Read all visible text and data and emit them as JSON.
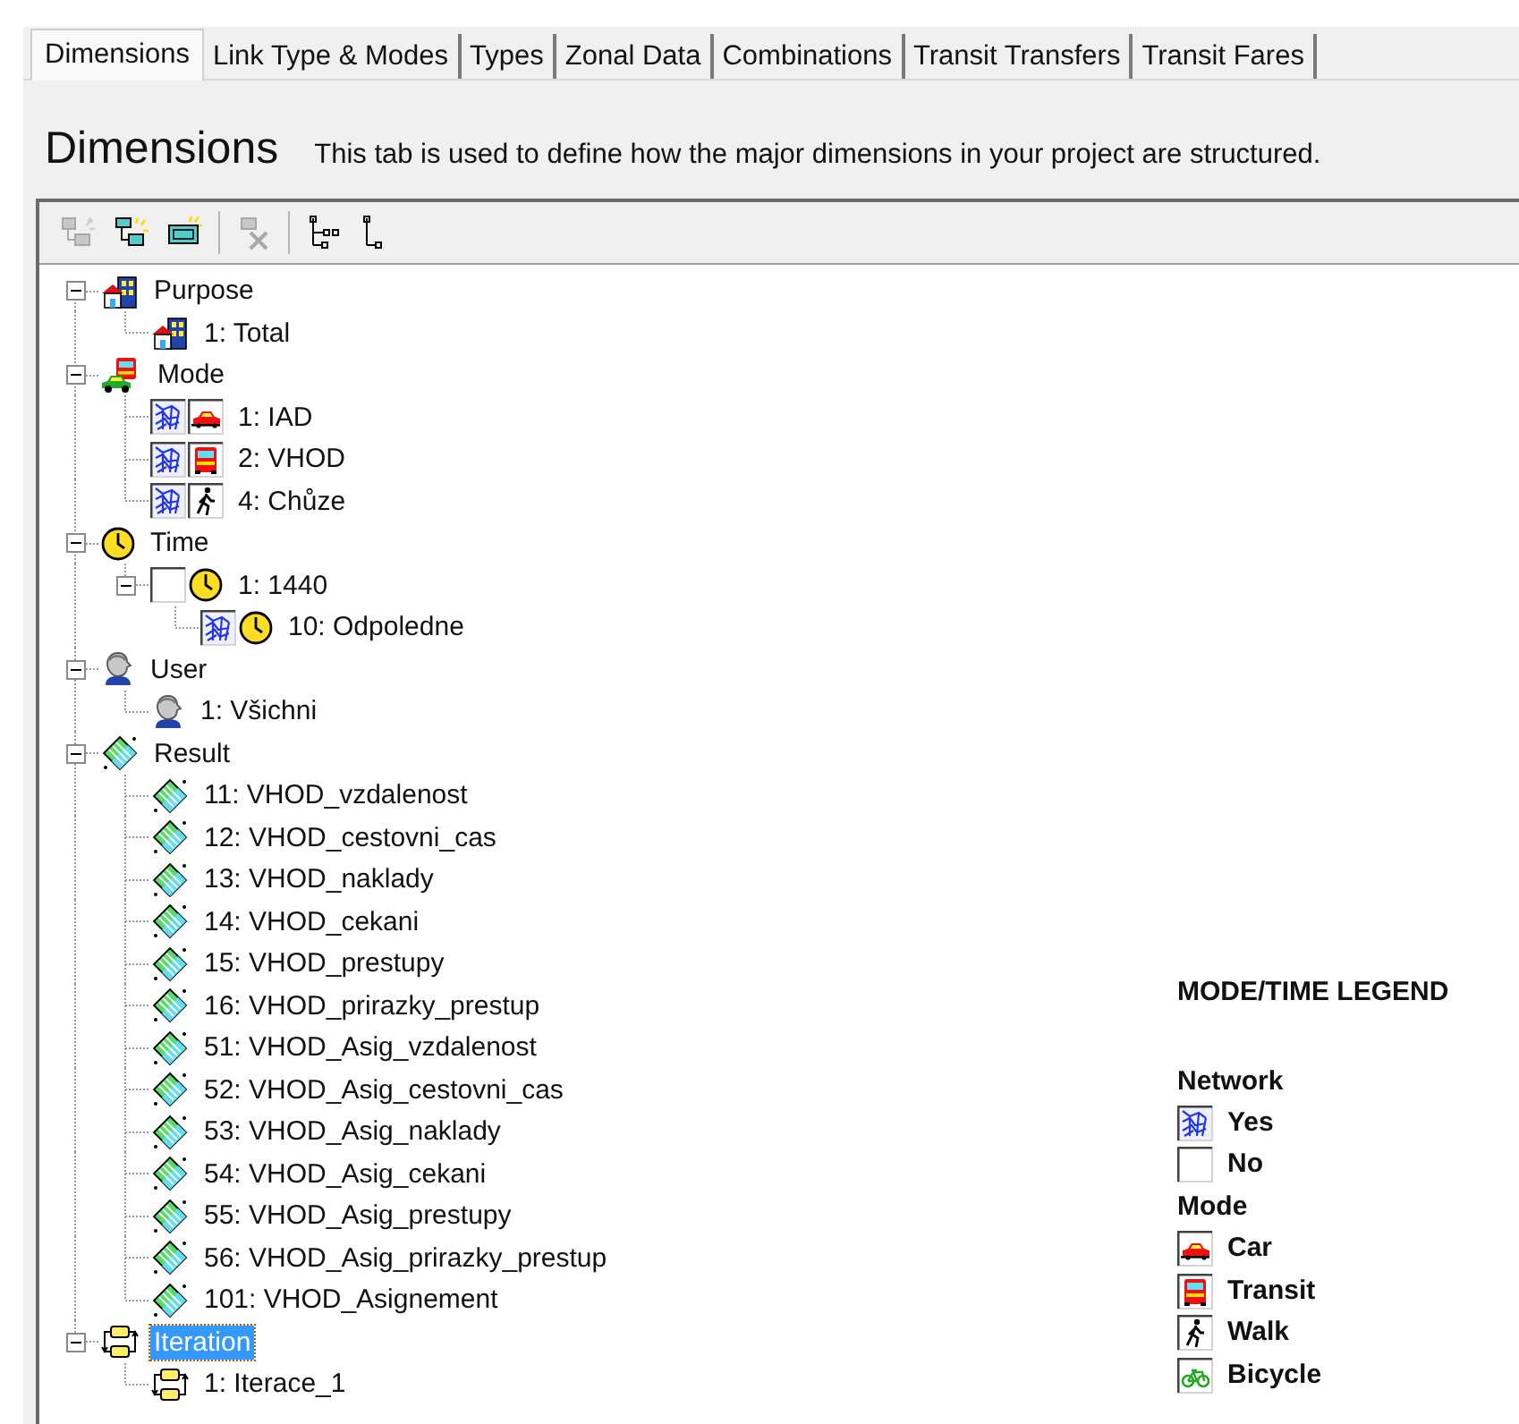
{
  "tabs": [
    {
      "label": "Dimensions",
      "selected": true
    },
    {
      "label": "Link Type & Modes",
      "selected": false
    },
    {
      "label": "Types",
      "selected": false
    },
    {
      "label": "Zonal Data",
      "selected": false
    },
    {
      "label": "Combinations",
      "selected": false
    },
    {
      "label": "Transit Transfers",
      "selected": false
    },
    {
      "label": "Transit Fares",
      "selected": false
    }
  ],
  "header": {
    "title": "Dimensions",
    "description": "This tab is used to define how the major dimensions in your project are structured."
  },
  "toolbar": [
    {
      "kind": "add_group",
      "disabled": true
    },
    {
      "kind": "add_item",
      "disabled": false
    },
    {
      "kind": "add_number",
      "disabled": false
    },
    {
      "kind": "delete",
      "disabled": true
    },
    {
      "kind": "expand",
      "disabled": false
    },
    {
      "kind": "collapse",
      "disabled": false
    }
  ],
  "tree": [
    {
      "label": "Purpose",
      "kind": "purpose",
      "expanded": true,
      "selected": false,
      "children": [
        {
          "label": "1: Total",
          "kind": "purpose",
          "selected": false
        }
      ]
    },
    {
      "label": "Mode",
      "kind": "mode",
      "expanded": true,
      "selected": false,
      "children": [
        {
          "label": "1: IAD",
          "kind": "car",
          "network": true,
          "selected": false
        },
        {
          "label": "2: VHOD",
          "kind": "transit",
          "network": true,
          "selected": false
        },
        {
          "label": "4: Chůze",
          "kind": "walk",
          "network": true,
          "selected": false
        }
      ]
    },
    {
      "label": "Time",
      "kind": "time",
      "expanded": true,
      "selected": false,
      "children": [
        {
          "label": "1: 1440",
          "kind": "time",
          "network": false,
          "expanded": true,
          "selected": false,
          "children": [
            {
              "label": "10: Odpoledne",
              "kind": "time",
              "network": true,
              "selected": false
            }
          ]
        }
      ]
    },
    {
      "label": "User",
      "kind": "user",
      "expanded": true,
      "selected": false,
      "children": [
        {
          "label": "1: Všichni",
          "kind": "user",
          "selected": false
        }
      ]
    },
    {
      "label": "Result",
      "kind": "result",
      "expanded": true,
      "selected": false,
      "children": [
        {
          "label": "11: VHOD_vzdalenost",
          "kind": "result",
          "selected": false
        },
        {
          "label": "12: VHOD_cestovni_cas",
          "kind": "result",
          "selected": false
        },
        {
          "label": "13: VHOD_naklady",
          "kind": "result",
          "selected": false
        },
        {
          "label": "14: VHOD_cekani",
          "kind": "result",
          "selected": false
        },
        {
          "label": "15: VHOD_prestupy",
          "kind": "result",
          "selected": false
        },
        {
          "label": "16: VHOD_prirazky_prestup",
          "kind": "result",
          "selected": false
        },
        {
          "label": "51: VHOD_Asig_vzdalenost",
          "kind": "result",
          "selected": false
        },
        {
          "label": "52: VHOD_Asig_cestovni_cas",
          "kind": "result",
          "selected": false
        },
        {
          "label": "53: VHOD_Asig_naklady",
          "kind": "result",
          "selected": false
        },
        {
          "label": "54: VHOD_Asig_cekani",
          "kind": "result",
          "selected": false
        },
        {
          "label": "55: VHOD_Asig_prestupy",
          "kind": "result",
          "selected": false
        },
        {
          "label": "56: VHOD_Asig_prirazky_prestup",
          "kind": "result",
          "selected": false
        },
        {
          "label": "101: VHOD_Asignement",
          "kind": "result",
          "selected": false
        }
      ]
    },
    {
      "label": "Iteration",
      "kind": "iteration",
      "expanded": true,
      "selected": true,
      "children": [
        {
          "label": "1: Iterace_1",
          "kind": "iteration",
          "selected": false
        }
      ]
    }
  ],
  "legend": {
    "title": "MODE/TIME LEGEND",
    "sections": [
      {
        "heading": "Network",
        "items": [
          {
            "label": "Yes",
            "kind": "network"
          },
          {
            "label": "No",
            "kind": "no_network"
          }
        ]
      },
      {
        "heading": "Mode",
        "items": [
          {
            "label": "Car",
            "kind": "car"
          },
          {
            "label": "Transit",
            "kind": "transit"
          },
          {
            "label": "Walk",
            "kind": "walk"
          },
          {
            "label": "Bicycle",
            "kind": "bicycle"
          }
        ]
      }
    ]
  }
}
